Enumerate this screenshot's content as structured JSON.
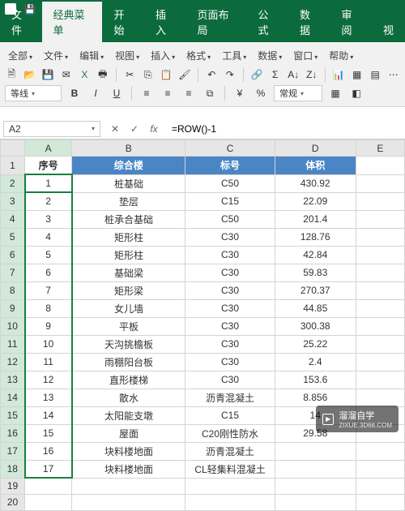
{
  "qat": {
    "save": "💾",
    "undo": "↶",
    "redo": "↷"
  },
  "tabs": [
    "文件",
    "经典菜单",
    "开始",
    "插入",
    "页面布局",
    "公式",
    "数据",
    "审阅",
    "视"
  ],
  "active_tab": 1,
  "ribbon_menu": [
    "全部",
    "文件",
    "编辑",
    "视图",
    "插入",
    "格式",
    "工具",
    "数据",
    "窗口",
    "帮助"
  ],
  "line_style_label": "等线",
  "general_label": "常规",
  "namebox": "A2",
  "formula": "=ROW()-1",
  "columns": [
    "A",
    "B",
    "C",
    "D",
    "E"
  ],
  "header_row": [
    "序号",
    "综合楼",
    "标号",
    "体积"
  ],
  "chart_data": {
    "type": "table",
    "columns": [
      "序号",
      "综合楼",
      "标号",
      "体积"
    ],
    "rows": [
      [
        1,
        "桩基础",
        "C50",
        430.92
      ],
      [
        2,
        "垫层",
        "C15",
        22.09
      ],
      [
        3,
        "桩承合基础",
        "C50",
        201.4
      ],
      [
        4,
        "矩形柱",
        "C30",
        128.76
      ],
      [
        5,
        "矩形柱",
        "C30",
        42.84
      ],
      [
        6,
        "基础梁",
        "C30",
        59.83
      ],
      [
        7,
        "矩形梁",
        "C30",
        270.37
      ],
      [
        8,
        "女儿墙",
        "C30",
        44.85
      ],
      [
        9,
        "平板",
        "C30",
        300.38
      ],
      [
        10,
        "天沟挑檐板",
        "C30",
        25.22
      ],
      [
        11,
        "雨棚阳台板",
        "C30",
        2.4
      ],
      [
        12,
        "直形楼梯",
        "C30",
        153.6
      ],
      [
        13,
        "散水",
        "沥青混凝土",
        8.856
      ],
      [
        14,
        "太阳能支墩",
        "C15",
        14
      ],
      [
        15,
        "屋面",
        "C20刚性防水",
        29.58
      ],
      [
        16,
        "块料楼地面",
        "沥青混凝土",
        ""
      ],
      [
        17,
        "块料楼地面",
        "CL轻集料混凝土",
        ""
      ]
    ]
  },
  "watermark": {
    "brand": "溜溜自学",
    "url": "ZIXUE.3D66.COM"
  }
}
